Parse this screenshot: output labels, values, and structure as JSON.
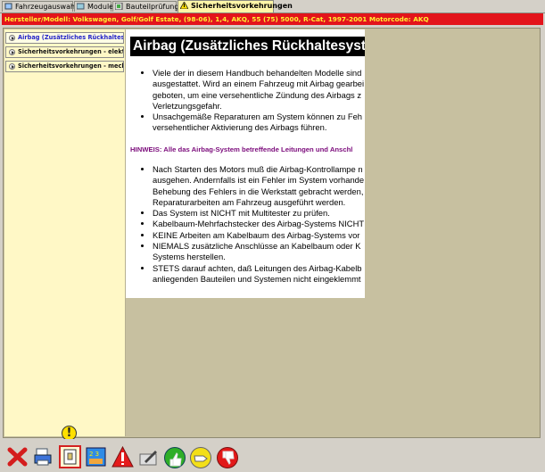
{
  "tabs": [
    {
      "label": "Fahrzeugauswahl",
      "icon": "car-select-icon"
    },
    {
      "label": "Module",
      "icon": "module-icon"
    },
    {
      "label": "Bauteilprüfung",
      "icon": "component-test-icon"
    },
    {
      "label": "Sicherheitsvorkehrungen",
      "icon": "warning-icon",
      "active": true
    }
  ],
  "vehicle": {
    "text": "Hersteller/Modell: Volkswagen, Golf/Golf Estate, (98-06), 1,4, AKQ, 55 (75) 5000, R-Cat, 1997-2001  Motorcode: AKQ"
  },
  "sidebar": {
    "items": [
      {
        "label": "Airbag (Zusätzliches Rückhaltesystem)",
        "selected": true
      },
      {
        "label": "Sicherheitsvorkehrungen - elektrisch"
      },
      {
        "label": "Sicherheitsvorkehrungen - mechanisch"
      }
    ]
  },
  "content": {
    "title": "Airbag (Zusätzliches Rückhaltesystem)",
    "bullets_1": [
      "Viele der in diesem Handbuch behandelten Modelle sind ausgestattet. Wird an einem Fahrzeug mit Airbag gearbei geboten, um eine versehentliche Zündung des Airbags z Verletzungsgefahr.",
      "Unsachgemäße Reparaturen am System können zu Feh versehentlicher Aktivierung des Airbags führen."
    ],
    "note": "HINWEIS: Alle das Airbag-System betreffende Leitungen und Anschl",
    "bullets_2": [
      "Nach Starten des Motors muß die Airbag-Kontrollampe n ausgehen. Andernfalls ist ein Fehler im System vorhande Behebung des Fehlers in die Werkstatt gebracht werden, Reparaturarbeiten am Fahrzeug ausgeführt werden.",
      "Das System ist NICHT mit Multitester zu prüfen.",
      "Kabelbaum-Mehrfachstecker des Airbag-Systems NICHT",
      "KEINE Arbeiten am Kabelbaum des Airbag-Systems vor",
      "NIEMALS zusätzliche Anschlüsse an Kabelbaum oder K Systems herstellen.",
      "STETS darauf achten, daß Leitungen des Airbag-Kabelb anliegenden Bauteilen und Systemen nicht eingeklemmt"
    ]
  },
  "toolbar": {
    "buttons": [
      {
        "icon": "close-icon",
        "label": "close"
      },
      {
        "icon": "print-icon",
        "label": "print"
      },
      {
        "icon": "safety-document-icon",
        "label": "safety document"
      },
      {
        "icon": "numbers-icon",
        "label": "numbers"
      },
      {
        "icon": "hazard-icon",
        "label": "hazard"
      },
      {
        "icon": "edit-note-icon",
        "label": "edit note"
      },
      {
        "icon": "thumbs-up-icon",
        "label": "thumbs up"
      },
      {
        "icon": "hand-right-icon",
        "label": "hand right"
      },
      {
        "icon": "thumbs-down-icon",
        "label": "thumbs down"
      }
    ]
  }
}
